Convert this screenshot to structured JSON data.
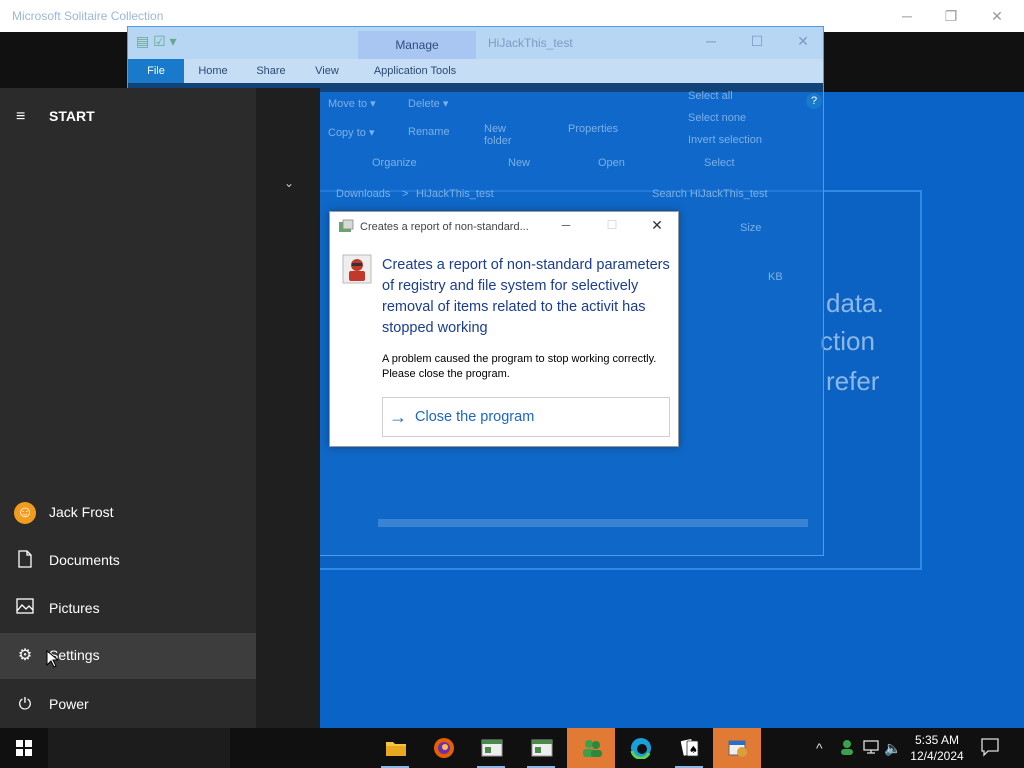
{
  "solitaire": {
    "title": "Microsoft Solitaire Collection",
    "min": "─",
    "restore": "❐",
    "close": "✕",
    "bg_text": [
      "data.",
      "ction",
      "refer"
    ]
  },
  "explorer": {
    "name": "HiJackThis_test",
    "manage_tab": "Manage",
    "tabs": [
      "File",
      "Home",
      "Share",
      "View",
      "Application Tools"
    ],
    "help": "?",
    "min": "─",
    "max": "☐",
    "close": "✕",
    "ribbon": {
      "move_to": "Move to ▾",
      "delete": "Delete ▾",
      "copy_to": "Copy to ▾",
      "rename": "Rename",
      "new_folder": "New folder",
      "properties": "Properties",
      "select_all": "Select all",
      "select_none": "Select none",
      "invert_selection": "Invert selection",
      "group_organize": "Organize",
      "group_new": "New",
      "group_open": "Open",
      "group_select": "Select"
    },
    "address": {
      "path_1": "Downloads",
      "sep": ">",
      "path_2": "HiJackThis_test",
      "search_placeholder": "Search HiJackThis_test"
    },
    "col_size": "Size",
    "file_size": "KB"
  },
  "start_menu": {
    "label": "START",
    "hamburger": "≡",
    "chevron": "⌄",
    "items": [
      {
        "label": "Jack Frost",
        "icon": "user-avatar-icon"
      },
      {
        "label": "Documents",
        "icon": "document-icon"
      },
      {
        "label": "Pictures",
        "icon": "pictures-icon"
      },
      {
        "label": "Settings",
        "icon": "gear-icon"
      },
      {
        "label": "Power",
        "icon": "power-icon"
      }
    ]
  },
  "dialog": {
    "title": "Creates a report of non-standard...",
    "min": "─",
    "max": "☐",
    "close": "✕",
    "heading": "Creates a report of non-standard parameters of registry and file system for selectively removal of items related to the activit has stopped working",
    "message": "A problem caused the program to stop working correctly. Please close the program.",
    "button_label": "Close the program",
    "button_arrow": "→"
  },
  "taskbar": {
    "clock_time": "5:35 AM",
    "clock_date": "12/4/2024",
    "apps": [
      {
        "name": "file-explorer-icon"
      },
      {
        "name": "firefox-icon"
      },
      {
        "name": "app-window-icon"
      },
      {
        "name": "app-window-icon"
      },
      {
        "name": "hijackthis-users-icon"
      },
      {
        "name": "edge-icon"
      },
      {
        "name": "solitaire-icon"
      },
      {
        "name": "hijackthis-icon"
      }
    ],
    "tray_chevron": "^",
    "tray_volume": "🔈"
  },
  "colors": {
    "desktop": "#0a62c4",
    "accent": "#1a66c2",
    "taskbar_active": "#e07a34",
    "start_bg": "#2b2b2b"
  }
}
